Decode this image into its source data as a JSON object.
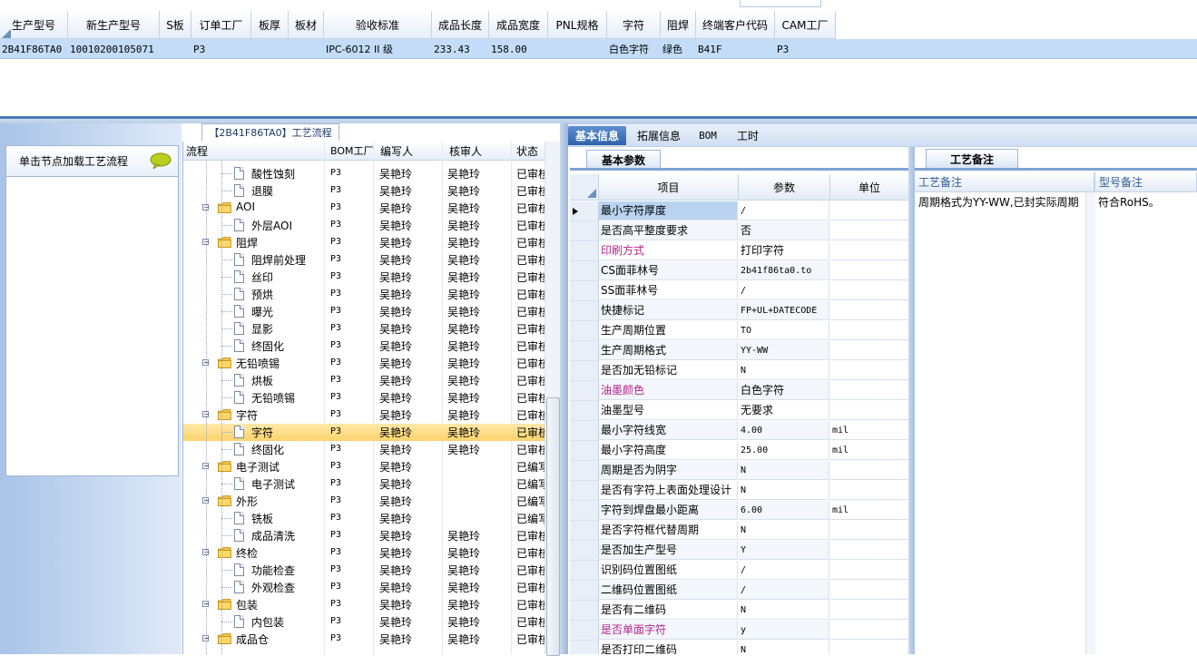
{
  "top_grid": {
    "headers": [
      "生产型号",
      "新生产型号",
      "S板",
      "订单工厂",
      "板厚",
      "板材",
      "验收标准",
      "成品长度",
      "成品宽度",
      "PNL规格",
      "字符",
      "阻焊",
      "终端客户代码",
      "CAM工厂"
    ],
    "row": [
      "2B41F86TA0",
      "10010200105071",
      "",
      "P3",
      "",
      "",
      "IPC-6012 II 级",
      "233.43",
      "158.00",
      "",
      "白色字符",
      "绿色",
      "B41F",
      "P3"
    ]
  },
  "flow_tab": "【2B41F86TA0】工艺流程",
  "load_label": "单击节点加载工艺流程",
  "tree": {
    "headers": [
      "流程",
      "BOM工厂",
      "编写人",
      "核审人",
      "状态"
    ],
    "rows": [
      {
        "name": "酸性蚀刻",
        "level": 2,
        "bom": "P3",
        "writer": "吴艳玲",
        "reviewer": "吴艳玲",
        "status": "已审核"
      },
      {
        "name": "退膜",
        "level": 2,
        "bom": "P3",
        "writer": "吴艳玲",
        "reviewer": "吴艳玲",
        "status": "已审核"
      },
      {
        "name": "AOI",
        "level": 1,
        "bom": "P3",
        "writer": "吴艳玲",
        "reviewer": "吴艳玲",
        "status": "已审核"
      },
      {
        "name": "外层AOI",
        "level": 2,
        "bom": "P3",
        "writer": "吴艳玲",
        "reviewer": "吴艳玲",
        "status": "已审核"
      },
      {
        "name": "阻焊",
        "level": 1,
        "bom": "P3",
        "writer": "吴艳玲",
        "reviewer": "吴艳玲",
        "status": "已审核"
      },
      {
        "name": "阻焊前处理",
        "level": 2,
        "bom": "P3",
        "writer": "吴艳玲",
        "reviewer": "吴艳玲",
        "status": "已审核"
      },
      {
        "name": "丝印",
        "level": 2,
        "bom": "P3",
        "writer": "吴艳玲",
        "reviewer": "吴艳玲",
        "status": "已审核"
      },
      {
        "name": "预烘",
        "level": 2,
        "bom": "P3",
        "writer": "吴艳玲",
        "reviewer": "吴艳玲",
        "status": "已审核"
      },
      {
        "name": "曝光",
        "level": 2,
        "bom": "P3",
        "writer": "吴艳玲",
        "reviewer": "吴艳玲",
        "status": "已审核"
      },
      {
        "name": "显影",
        "level": 2,
        "bom": "P3",
        "writer": "吴艳玲",
        "reviewer": "吴艳玲",
        "status": "已审核"
      },
      {
        "name": "终固化",
        "level": 2,
        "bom": "P3",
        "writer": "吴艳玲",
        "reviewer": "吴艳玲",
        "status": "已审核"
      },
      {
        "name": "无铅喷锡",
        "level": 1,
        "bom": "P3",
        "writer": "吴艳玲",
        "reviewer": "吴艳玲",
        "status": "已审核"
      },
      {
        "name": "烘板",
        "level": 2,
        "bom": "P3",
        "writer": "吴艳玲",
        "reviewer": "吴艳玲",
        "status": "已审核"
      },
      {
        "name": "无铅喷锡",
        "level": 2,
        "bom": "P3",
        "writer": "吴艳玲",
        "reviewer": "吴艳玲",
        "status": "已审核"
      },
      {
        "name": "字符",
        "level": 1,
        "bom": "P3",
        "writer": "吴艳玲",
        "reviewer": "吴艳玲",
        "status": "已审核"
      },
      {
        "name": "字符",
        "level": 2,
        "bom": "P3",
        "writer": "吴艳玲",
        "reviewer": "吴艳玲",
        "status": "已审核",
        "selected": true
      },
      {
        "name": "终固化",
        "level": 2,
        "bom": "P3",
        "writer": "吴艳玲",
        "reviewer": "吴艳玲",
        "status": "已审核"
      },
      {
        "name": "电子测试",
        "level": 1,
        "bom": "P3",
        "writer": "吴艳玲",
        "reviewer": "",
        "status": "已编写"
      },
      {
        "name": "电子测试",
        "level": 2,
        "bom": "P3",
        "writer": "吴艳玲",
        "reviewer": "",
        "status": "已编写"
      },
      {
        "name": "外形",
        "level": 1,
        "bom": "P3",
        "writer": "吴艳玲",
        "reviewer": "",
        "status": "已编写"
      },
      {
        "name": "铣板",
        "level": 2,
        "bom": "P3",
        "writer": "吴艳玲",
        "reviewer": "",
        "status": "已编写"
      },
      {
        "name": "成品清洗",
        "level": 2,
        "bom": "P3",
        "writer": "吴艳玲",
        "reviewer": "吴艳玲",
        "status": "已审核"
      },
      {
        "name": "终检",
        "level": 1,
        "bom": "P3",
        "writer": "吴艳玲",
        "reviewer": "吴艳玲",
        "status": "已审核"
      },
      {
        "name": "功能检查",
        "level": 2,
        "bom": "P3",
        "writer": "吴艳玲",
        "reviewer": "吴艳玲",
        "status": "已审核"
      },
      {
        "name": "外观检查",
        "level": 2,
        "bom": "P3",
        "writer": "吴艳玲",
        "reviewer": "吴艳玲",
        "status": "已审核"
      },
      {
        "name": "包装",
        "level": 1,
        "bom": "P3",
        "writer": "吴艳玲",
        "reviewer": "吴艳玲",
        "status": "已审核"
      },
      {
        "name": "内包装",
        "level": 2,
        "bom": "P3",
        "writer": "吴艳玲",
        "reviewer": "吴艳玲",
        "status": "已审核"
      },
      {
        "name": "成品仓",
        "level": 1,
        "bom": "P3",
        "writer": "吴艳玲",
        "reviewer": "吴艳玲",
        "status": "已审核"
      }
    ]
  },
  "tabs": [
    "基本信息",
    "拓展信息",
    "BOM",
    "工时"
  ],
  "basic_subtab": "基本参数",
  "param_headers": [
    "项目",
    "参数",
    "单位"
  ],
  "params": [
    {
      "item": "最小字符厚度",
      "value": "/",
      "unit": ""
    },
    {
      "item": "是否高平整度要求",
      "value": "否",
      "unit": ""
    },
    {
      "item": "印刷方式",
      "value": "打印字符",
      "unit": "",
      "magenta": true
    },
    {
      "item": "CS面菲林号",
      "value": "2b41f86ta0.to",
      "unit": ""
    },
    {
      "item": "SS面菲林号",
      "value": "/",
      "unit": ""
    },
    {
      "item": "快捷标记",
      "value": "FP+UL+DATECODE",
      "unit": ""
    },
    {
      "item": "生产周期位置",
      "value": "TO",
      "unit": ""
    },
    {
      "item": "生产周期格式",
      "value": "YY-WW",
      "unit": ""
    },
    {
      "item": "是否加无铅标记",
      "value": "N",
      "unit": ""
    },
    {
      "item": "油墨颜色",
      "value": "白色字符",
      "unit": "",
      "magenta": true
    },
    {
      "item": "油墨型号",
      "value": "无要求",
      "unit": ""
    },
    {
      "item": "最小字符线宽",
      "value": "4.00",
      "unit": "mil"
    },
    {
      "item": "最小字符高度",
      "value": "25.00",
      "unit": "mil"
    },
    {
      "item": "周期是否为阴字",
      "value": "N",
      "unit": ""
    },
    {
      "item": "是否有字符上表面处理设计",
      "value": "N",
      "unit": ""
    },
    {
      "item": "字符到焊盘最小距离",
      "value": "6.00",
      "unit": "mil"
    },
    {
      "item": "是否字符框代替周期",
      "value": "N",
      "unit": ""
    },
    {
      "item": "是否加生产型号",
      "value": "Y",
      "unit": ""
    },
    {
      "item": "识别码位置图纸",
      "value": "/",
      "unit": ""
    },
    {
      "item": "二维码位置图纸",
      "value": "/",
      "unit": ""
    },
    {
      "item": "是否有二维码",
      "value": "N",
      "unit": ""
    },
    {
      "item": "是否单面字符",
      "value": "y",
      "unit": "",
      "magenta": true
    },
    {
      "item": "是否打印二维码",
      "value": "N",
      "unit": ""
    }
  ],
  "note_tab": "工艺备注",
  "note_headers": [
    "工艺备注",
    "型号备注"
  ],
  "notes": [
    "周期格式为YY-WW,已封实际周期",
    "符合RoHS。"
  ],
  "colors": {
    "selected_row": "#c4dcf7",
    "active_tab": "#3c6fb5",
    "magenta": "#b4238e"
  }
}
